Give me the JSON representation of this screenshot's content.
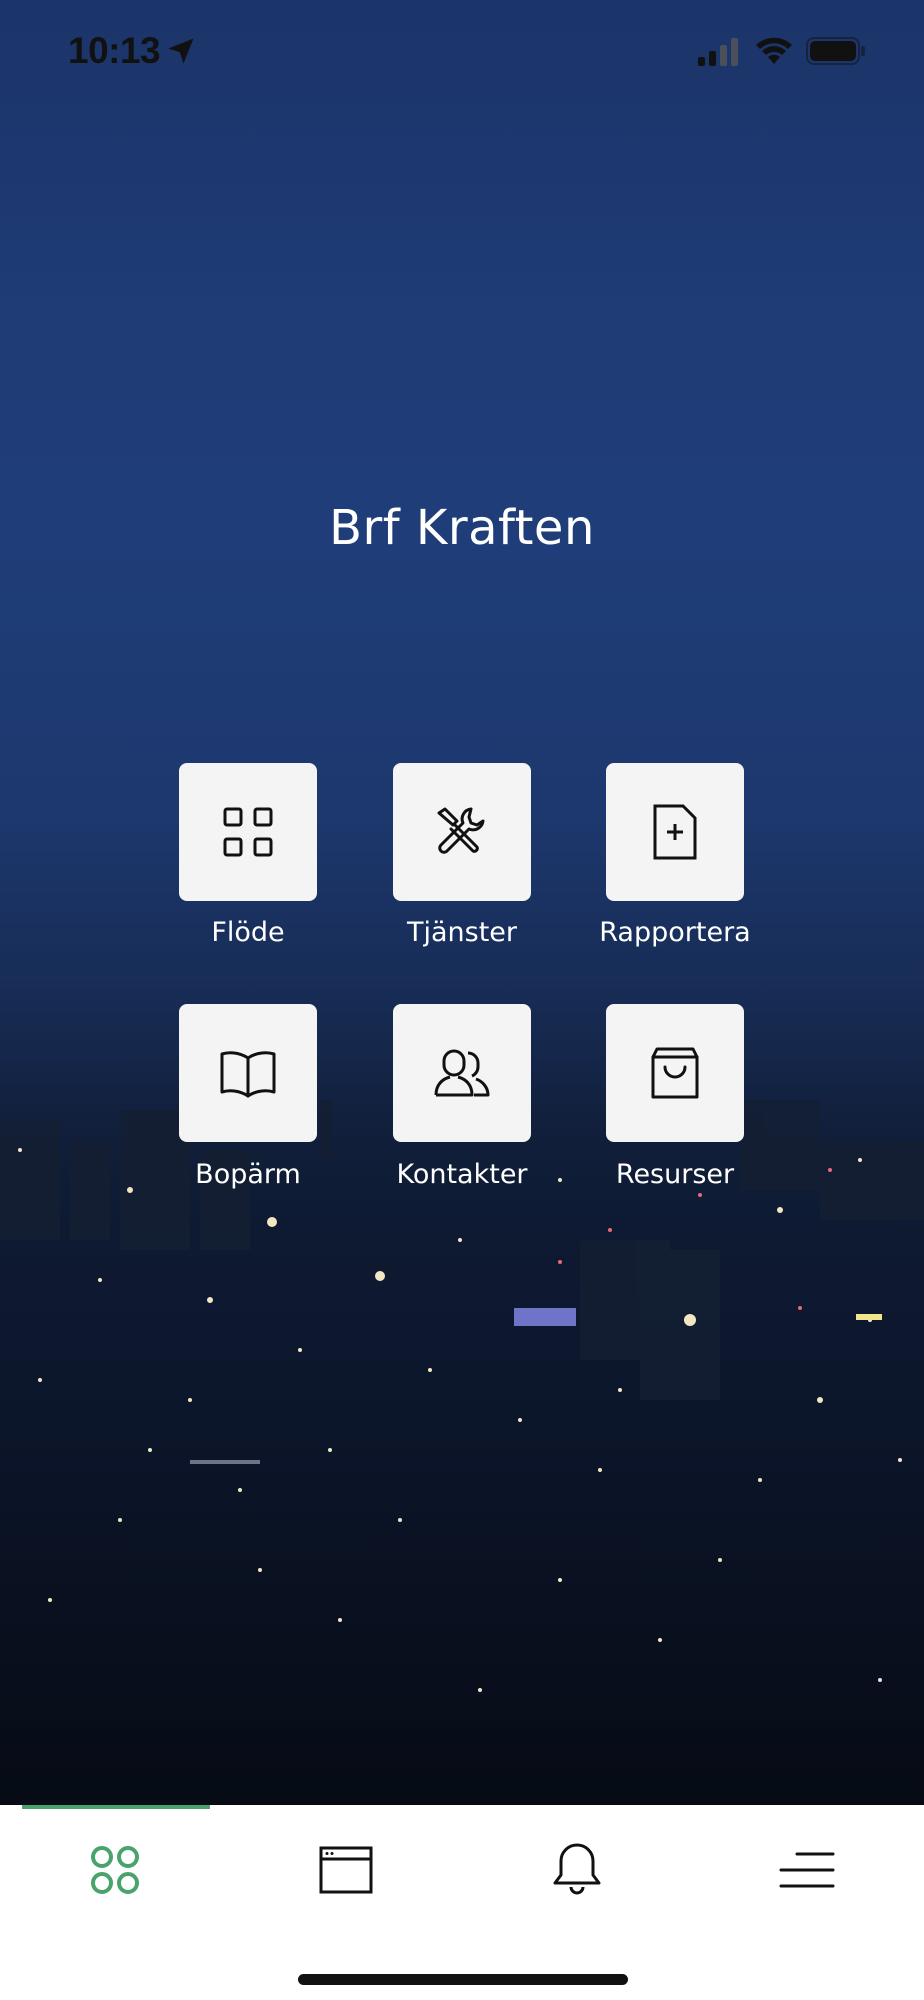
{
  "status_bar": {
    "time": "10:13",
    "icons": [
      "location-arrow-icon",
      "cellular-signal-icon",
      "wifi-icon",
      "battery-icon"
    ]
  },
  "header": {
    "title": "Brf Kraften"
  },
  "tiles": [
    {
      "label": "Flöde",
      "icon": "grid-icon"
    },
    {
      "label": "Tjänster",
      "icon": "tools-icon"
    },
    {
      "label": "Rapportera",
      "icon": "document-plus-icon"
    },
    {
      "label": "Bopärm",
      "icon": "book-icon"
    },
    {
      "label": "Kontakter",
      "icon": "contacts-icon"
    },
    {
      "label": "Resurser",
      "icon": "shopping-bag-icon"
    }
  ],
  "bottom_nav": {
    "items": [
      {
        "icon": "home-grid-icon",
        "active": true
      },
      {
        "icon": "browser-window-icon",
        "active": false
      },
      {
        "icon": "bell-icon",
        "active": false
      },
      {
        "icon": "menu-icon",
        "active": false
      }
    ],
    "active_color": "#4aa36c"
  },
  "colors": {
    "sky_top": "#1b3469",
    "tile_bg": "#f4f4f4",
    "accent": "#4aa36c"
  }
}
